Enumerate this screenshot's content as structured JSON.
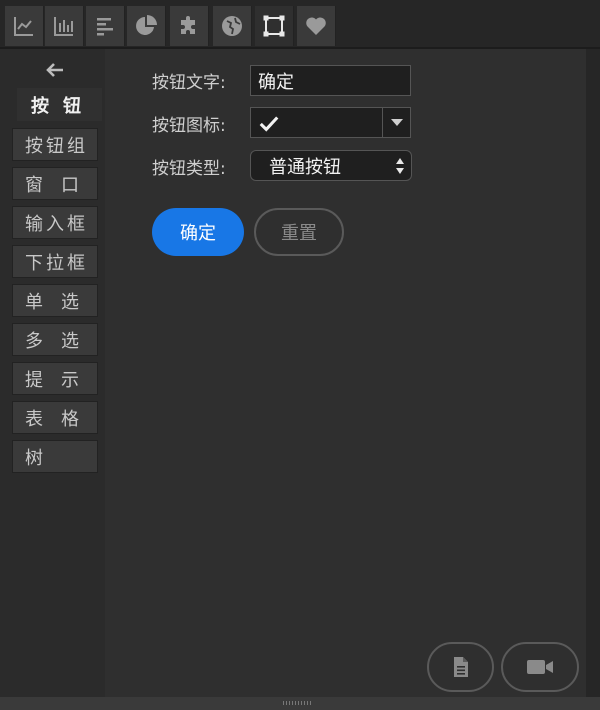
{
  "toolbar": {
    "tabs": [
      {
        "icon": "line-chart-icon"
      },
      {
        "icon": "bar-chart-icon"
      },
      {
        "icon": "horizontal-bar-chart-icon"
      },
      {
        "icon": "pie-chart-icon"
      },
      {
        "icon": "puzzle-icon"
      },
      {
        "icon": "globe-icon"
      },
      {
        "icon": "bounding-box-icon",
        "active": true
      },
      {
        "icon": "heart-icon"
      }
    ]
  },
  "sidebar": {
    "back_icon": "arrow-left-icon",
    "items": [
      {
        "label": "按钮",
        "active": true
      },
      {
        "label": "按钮组"
      },
      {
        "label": "窗口"
      },
      {
        "label": "输入框"
      },
      {
        "label": "下拉框"
      },
      {
        "label": "单选"
      },
      {
        "label": "多选"
      },
      {
        "label": "提示"
      },
      {
        "label": "表格"
      },
      {
        "label": "树"
      }
    ]
  },
  "form": {
    "text_label": "按钮文字:",
    "text_value": "确定",
    "icon_label": "按钮图标:",
    "icon_value": "check-icon",
    "type_label": "按钮类型:",
    "type_value": "普通按钮"
  },
  "preview": {
    "confirm_label": "确定",
    "reset_label": "重置"
  },
  "footer": {
    "doc_icon": "document-icon",
    "video_icon": "video-camera-icon"
  },
  "colors": {
    "accent": "#1877e6",
    "background": "#2f2f2f"
  }
}
